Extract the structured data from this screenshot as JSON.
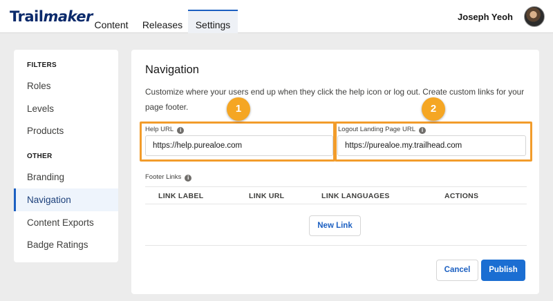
{
  "app": {
    "logo_text_bold": "Trail",
    "logo_text_script": "maker"
  },
  "nav": {
    "tabs": [
      {
        "label": "Content"
      },
      {
        "label": "Releases"
      },
      {
        "label": "Settings"
      }
    ],
    "active_tab": "Settings"
  },
  "user": {
    "name": "Joseph Yeoh"
  },
  "sidebar": {
    "sections": [
      {
        "heading": "FILTERS",
        "items": [
          {
            "label": "Roles"
          },
          {
            "label": "Levels"
          },
          {
            "label": "Products"
          }
        ]
      },
      {
        "heading": "OTHER",
        "items": [
          {
            "label": "Branding"
          },
          {
            "label": "Navigation"
          },
          {
            "label": "Content Exports"
          },
          {
            "label": "Badge Ratings"
          }
        ]
      }
    ],
    "active_item": "Navigation"
  },
  "main": {
    "title": "Navigation",
    "description": "Customize where your users end up when they click the help icon or log out. Create custom links for your page footer.",
    "help_url": {
      "label": "Help URL",
      "value": "https://help.purealoe.com",
      "callout": "1"
    },
    "logout_url": {
      "label": "Logout Landing Page URL",
      "value": "https://purealoe.my.trailhead.com",
      "callout": "2"
    },
    "footer_links": {
      "label": "Footer Links",
      "columns": [
        "LINK LABEL",
        "LINK URL",
        "LINK LANGUAGES",
        "ACTIONS"
      ],
      "new_link_label": "New Link"
    },
    "cancel_label": "Cancel",
    "publish_label": "Publish"
  },
  "colors": {
    "accent": "#1b6ed2",
    "callout": "#f5a623",
    "highlight_border": "#f29c2b"
  }
}
